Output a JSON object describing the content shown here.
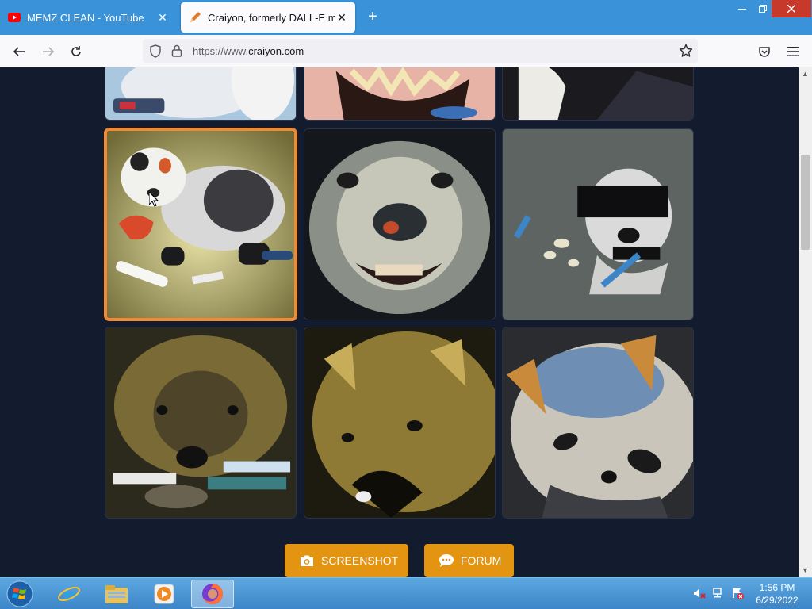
{
  "browser": {
    "tabs": [
      {
        "title": "MEMZ CLEAN - YouTube",
        "favicon": "youtube-icon",
        "active": false
      },
      {
        "title": "Craiyon, formerly DALL-E mini",
        "favicon": "crayon-icon",
        "active": true
      }
    ],
    "url_prefix": "https://www.",
    "url_domain": "craiyon.com"
  },
  "page": {
    "images": [
      {
        "subject": "cartoon character paws (cropped)"
      },
      {
        "subject": "open mouth with teeth (cropped)"
      },
      {
        "subject": "dark figure (cropped)"
      },
      {
        "subject": "black and white ferret with crayons",
        "selected": true
      },
      {
        "subject": "close-up grinning raccoon face"
      },
      {
        "subject": "raccoon with black bar over eyes"
      },
      {
        "subject": "brown furry animal with crayons"
      },
      {
        "subject": "golden furry animal face"
      },
      {
        "subject": "blue and orange raccoon"
      }
    ],
    "buttons": {
      "screenshot": "SCREENSHOT",
      "forum": "FORUM"
    }
  },
  "taskbar": {
    "time": "1:56 PM",
    "date": "6/29/2022"
  },
  "colors": {
    "accent": "#e39410",
    "selected_border": "#f08a36",
    "page_bg": "#131b2e",
    "tabstrip": "#3a92d8"
  }
}
